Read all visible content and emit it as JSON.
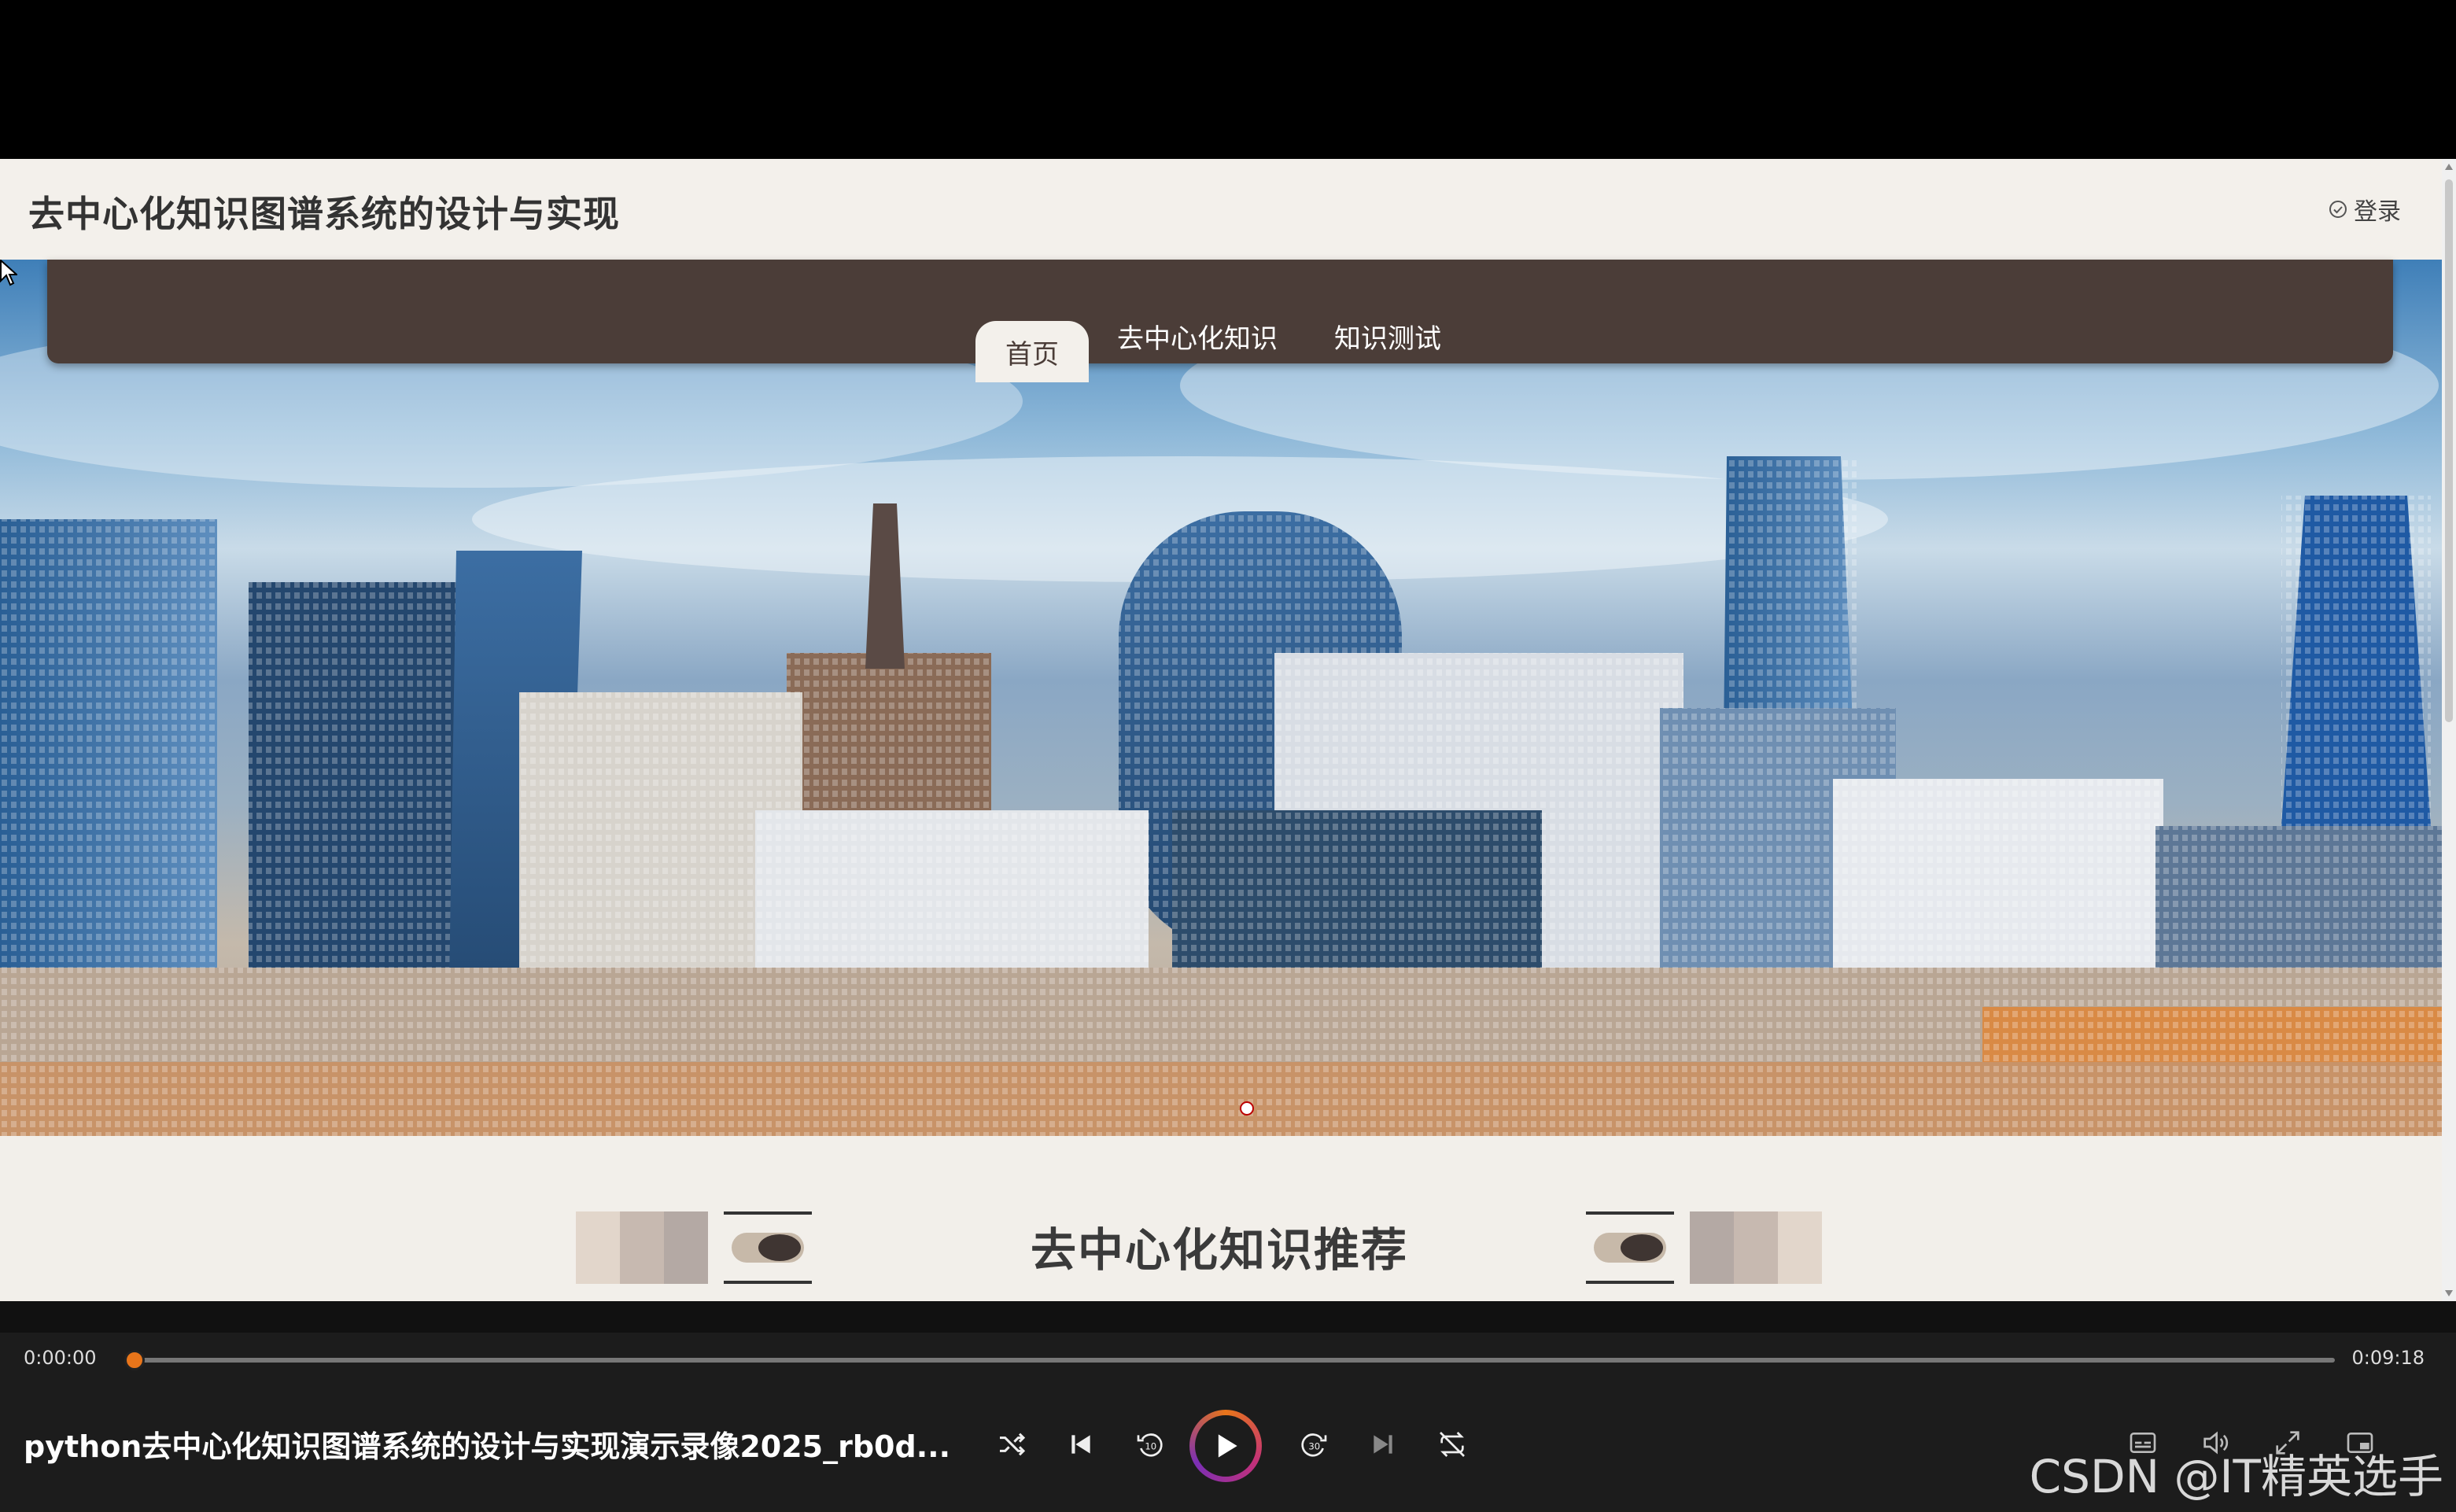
{
  "site": {
    "title": "去中心化知识图谱系统的设计与实现",
    "login": "登录"
  },
  "nav": {
    "items": [
      {
        "label": "首页",
        "active": true
      },
      {
        "label": "去中心化知识",
        "active": false
      },
      {
        "label": "知识测试",
        "active": false
      }
    ]
  },
  "section": {
    "title": "去中心化知识推荐"
  },
  "player": {
    "current_time": "0:00:00",
    "total_time": "0:09:18",
    "progress": 0,
    "video_title": "python去中心化知识图谱系统的设计与实现演示录像2025_rb0d...",
    "controls": [
      "shuffle-icon",
      "previous-icon",
      "rewind-10-icon",
      "play-icon",
      "forward-30-icon",
      "next-icon",
      "repeat-icon"
    ],
    "right_controls": [
      "subtitles-icon",
      "volume-icon",
      "fullscreen-icon",
      "mini-player-icon"
    ]
  },
  "watermark": "CSDN @IT精英选手",
  "colors": {
    "nav_bg": "#4b3d38",
    "page_bg": "#f2efea",
    "accent": "#e8751a"
  }
}
